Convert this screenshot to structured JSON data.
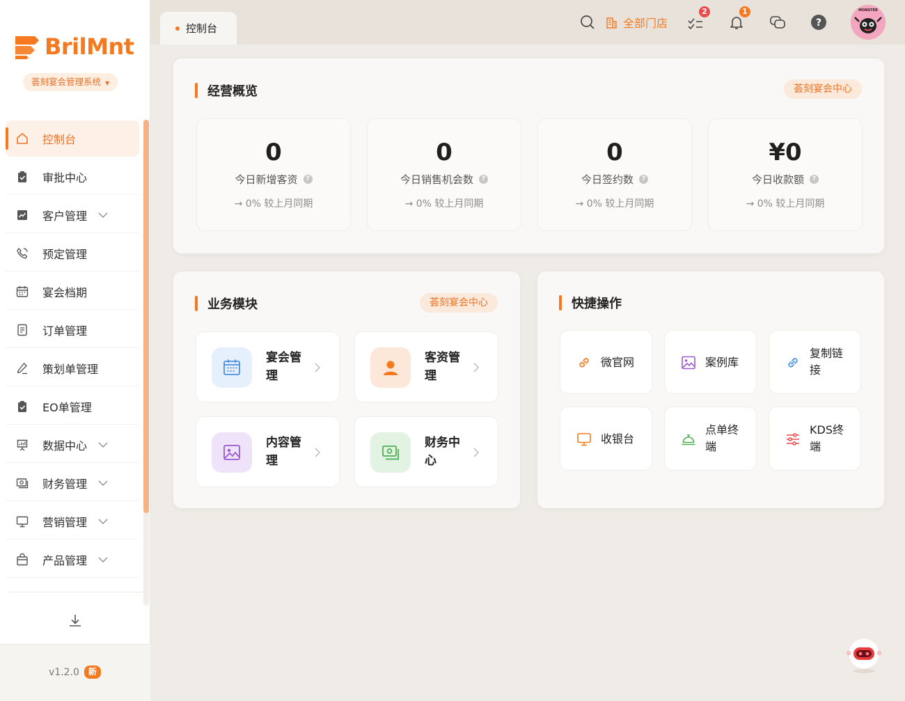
{
  "sidebar": {
    "brand": "BrilMnt",
    "system_name": "荟刻宴会管理系统",
    "menu": [
      {
        "label": "控制台",
        "icon": "home-icon",
        "active": true,
        "expandable": false
      },
      {
        "label": "审批中心",
        "icon": "clipboard-check-icon",
        "expandable": false
      },
      {
        "label": "客户管理",
        "icon": "chart-line-icon",
        "expandable": true
      },
      {
        "label": "预定管理",
        "icon": "phone-icon",
        "expandable": false
      },
      {
        "label": "宴会档期",
        "icon": "calendar-icon",
        "expandable": false
      },
      {
        "label": "订单管理",
        "icon": "document-icon",
        "expandable": false
      },
      {
        "label": "策划单管理",
        "icon": "pen-icon",
        "expandable": false
      },
      {
        "label": "EO单管理",
        "icon": "clipboard-check-icon",
        "expandable": false
      },
      {
        "label": "数据中心",
        "icon": "presentation-icon",
        "expandable": true
      },
      {
        "label": "财务管理",
        "icon": "money-icon",
        "expandable": true
      },
      {
        "label": "营销管理",
        "icon": "monitor-icon",
        "expandable": true
      },
      {
        "label": "产品管理",
        "icon": "bag-icon",
        "expandable": true
      }
    ],
    "version": "v1.2.0",
    "version_badge": "新"
  },
  "topbar": {
    "tab_label": "控制台",
    "store_label": "全部门店",
    "todo_count": "2",
    "notification_count": "1",
    "avatar_text": "MONSTER"
  },
  "overview": {
    "title": "经营概览",
    "tag": "荟刻宴会中心",
    "stats": [
      {
        "value": "0",
        "label": "今日新增客资",
        "compare": "→ 0% 较上月同期"
      },
      {
        "value": "0",
        "label": "今日销售机会数",
        "compare": "→ 0% 较上月同期"
      },
      {
        "value": "0",
        "label": "今日签约数",
        "compare": "→ 0% 较上月同期"
      },
      {
        "value": "¥0",
        "label": "今日收款额",
        "compare": "→ 0% 较上月同期"
      }
    ]
  },
  "modules": {
    "title": "业务模块",
    "tag": "荟刻宴会中心",
    "items": [
      {
        "line1": "宴会管",
        "line2": "理",
        "icon": "calendar-icon",
        "color": "#4a90e2"
      },
      {
        "line1": "客资管",
        "line2": "理",
        "icon": "user-icon",
        "color": "#f57a1f"
      },
      {
        "line1": "内容管",
        "line2": "理",
        "icon": "image-icon",
        "color": "#9b59d0"
      },
      {
        "line1": "财务中",
        "line2": "心",
        "icon": "money-icon",
        "color": "#4caf50"
      }
    ]
  },
  "quick": {
    "title": "快捷操作",
    "items": [
      {
        "line1": "微官网",
        "line2": "",
        "icon": "link-icon"
      },
      {
        "line1": "案例库",
        "line2": "",
        "icon": "image-icon"
      },
      {
        "line1": "复制链",
        "line2": "接",
        "icon": "link-icon"
      },
      {
        "line1": "收银台",
        "line2": "",
        "icon": "monitor-icon"
      },
      {
        "line1": "点单终",
        "line2": "端",
        "icon": "service-bell-icon"
      },
      {
        "line1": "KDS终",
        "line2": "端",
        "icon": "sliders-icon"
      }
    ]
  }
}
